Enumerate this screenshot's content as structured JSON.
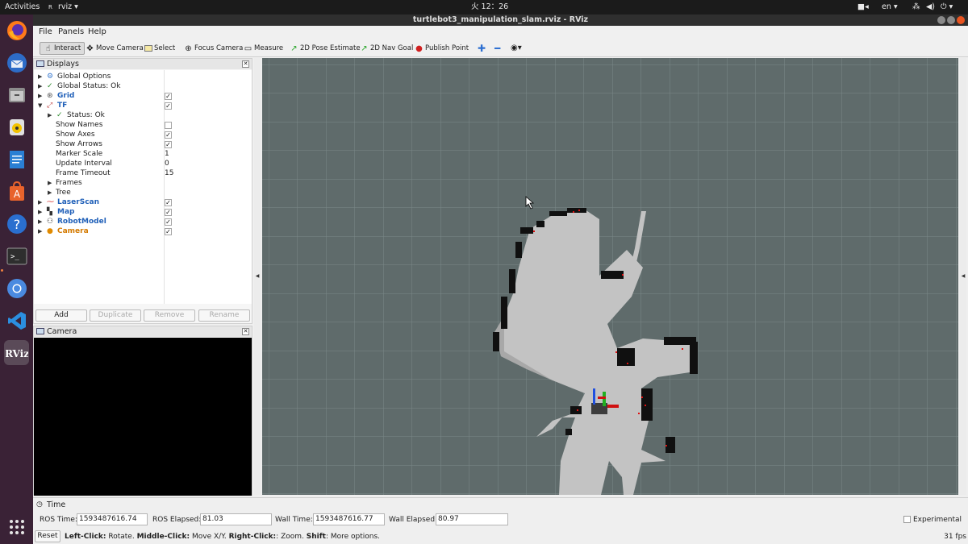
{
  "topbar": {
    "activities": "Activities",
    "app_menu": "rviz ▾",
    "clock": "火 12：26",
    "lang": "en ▾"
  },
  "window": {
    "title": "turtlebot3_manipulation_slam.rviz - RViz"
  },
  "menu": {
    "file": "File",
    "panels": "Panels",
    "help": "Help"
  },
  "toolbar": {
    "interact": "Interact",
    "move_camera": "Move Camera",
    "select": "Select",
    "focus_camera": "Focus Camera",
    "measure": "Measure",
    "pose_estimate": "2D Pose Estimate",
    "nav_goal": "2D Nav Goal",
    "publish_point": "Publish Point"
  },
  "displays": {
    "title": "Displays",
    "rows": [
      {
        "label": "Global Options"
      },
      {
        "label": "Global Status: Ok"
      },
      {
        "label": "Grid"
      },
      {
        "label": "TF"
      },
      {
        "label": "Status: Ok"
      },
      {
        "label": "Show Names"
      },
      {
        "label": "Show Axes"
      },
      {
        "label": "Show Arrows"
      },
      {
        "label": "Marker Scale",
        "value": "1"
      },
      {
        "label": "Update Interval",
        "value": "0"
      },
      {
        "label": "Frame Timeout",
        "value": "15"
      },
      {
        "label": "Frames"
      },
      {
        "label": "Tree"
      },
      {
        "label": "LaserScan"
      },
      {
        "label": "Map"
      },
      {
        "label": "RobotModel"
      },
      {
        "label": "Camera"
      }
    ],
    "buttons": {
      "add": "Add",
      "duplicate": "Duplicate",
      "remove": "Remove",
      "rename": "Rename"
    }
  },
  "camera_panel": {
    "title": "Camera"
  },
  "time": {
    "title": "Time",
    "ros_time_label": "ROS Time:",
    "ros_time": "1593487616.74",
    "ros_elapsed_label": "ROS Elapsed:",
    "ros_elapsed": "81.03",
    "wall_time_label": "Wall Time:",
    "wall_time": "1593487616.77",
    "wall_elapsed_label": "Wall Elapsed:",
    "wall_elapsed": "80.97",
    "experimental": "Experimental"
  },
  "status": {
    "reset": "Reset",
    "left_click": "Left-Click:",
    "left_click_desc": " Rotate. ",
    "middle_click": "Middle-Click:",
    "middle_click_desc": " Move X/Y. ",
    "right_click": "Right-Click:",
    "right_click_desc": ": Zoom. ",
    "shift": "Shift",
    "shift_desc": ": More options.",
    "fps": "31 fps"
  },
  "colors": {
    "grid_bg": "#5f6b6b",
    "grid_line": "#7f8b8b",
    "map_free": "#c8c8c8",
    "map_occupied": "#111111",
    "laser": "#e01010"
  }
}
